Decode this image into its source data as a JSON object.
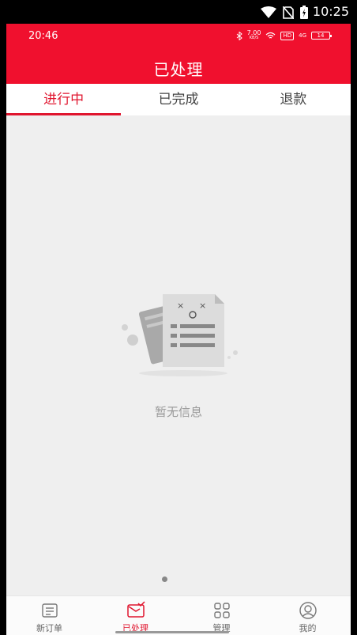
{
  "system_status": {
    "time": "10:25"
  },
  "app_status": {
    "time": "20:46",
    "speed": "7.00",
    "speed_unit": "KB/S",
    "hd": "HD",
    "net": "4G",
    "battery": "14"
  },
  "header": {
    "title": "已处理"
  },
  "tabs": [
    {
      "label": "进行中",
      "active": true
    },
    {
      "label": "已完成",
      "active": false
    },
    {
      "label": "退款",
      "active": false
    }
  ],
  "empty_state": {
    "message": "暂无信息"
  },
  "bottom_nav": [
    {
      "label": "新订单",
      "icon": "order-list-icon",
      "active": false
    },
    {
      "label": "已处理",
      "icon": "mail-check-icon",
      "active": true
    },
    {
      "label": "管理",
      "icon": "grid-icon",
      "active": false
    },
    {
      "label": "我的",
      "icon": "user-icon",
      "active": false
    }
  ],
  "colors": {
    "brand": "#f0102e",
    "active_text": "#e0152e",
    "background": "#efefef"
  }
}
